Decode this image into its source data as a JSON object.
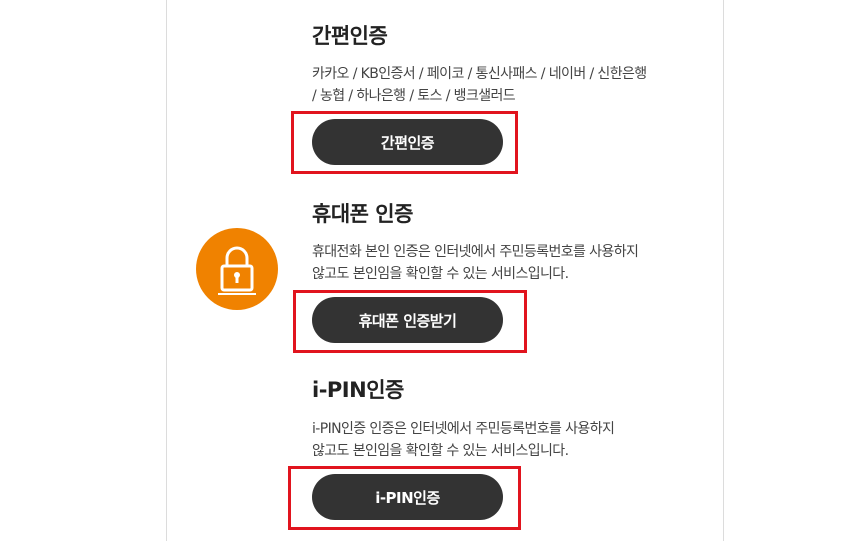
{
  "easy_auth": {
    "title": "간편인증",
    "desc_line1": "카카오 / KB인증서 / 페이코 / 통신사패스 / 네이버 / 신한은행",
    "desc_line2": "/ 농협 / 하나은행 / 토스 / 뱅크샐러드",
    "button_label": "간편인증"
  },
  "phone_auth": {
    "title": "휴대폰 인증",
    "desc_line1": "휴대전화 본인 인증은 인터넷에서 주민등록번호를 사용하지",
    "desc_line2": "않고도 본인임을 확인할 수 있는 서비스입니다.",
    "button_label": "휴대폰 인증받기"
  },
  "ipin_auth": {
    "title": "i-PIN인증",
    "desc_line1": "i-PIN인증 인증은 인터넷에서 주민등록번호를 사용하지",
    "desc_line2": "않고도 본인임을 확인할 수 있는 서비스입니다.",
    "button_label": "i-PIN인증"
  },
  "colors": {
    "accent_orange": "#f08200",
    "button_dark": "#333333",
    "highlight_red": "#e1141e"
  },
  "icons": {
    "lock": "lock-icon"
  }
}
